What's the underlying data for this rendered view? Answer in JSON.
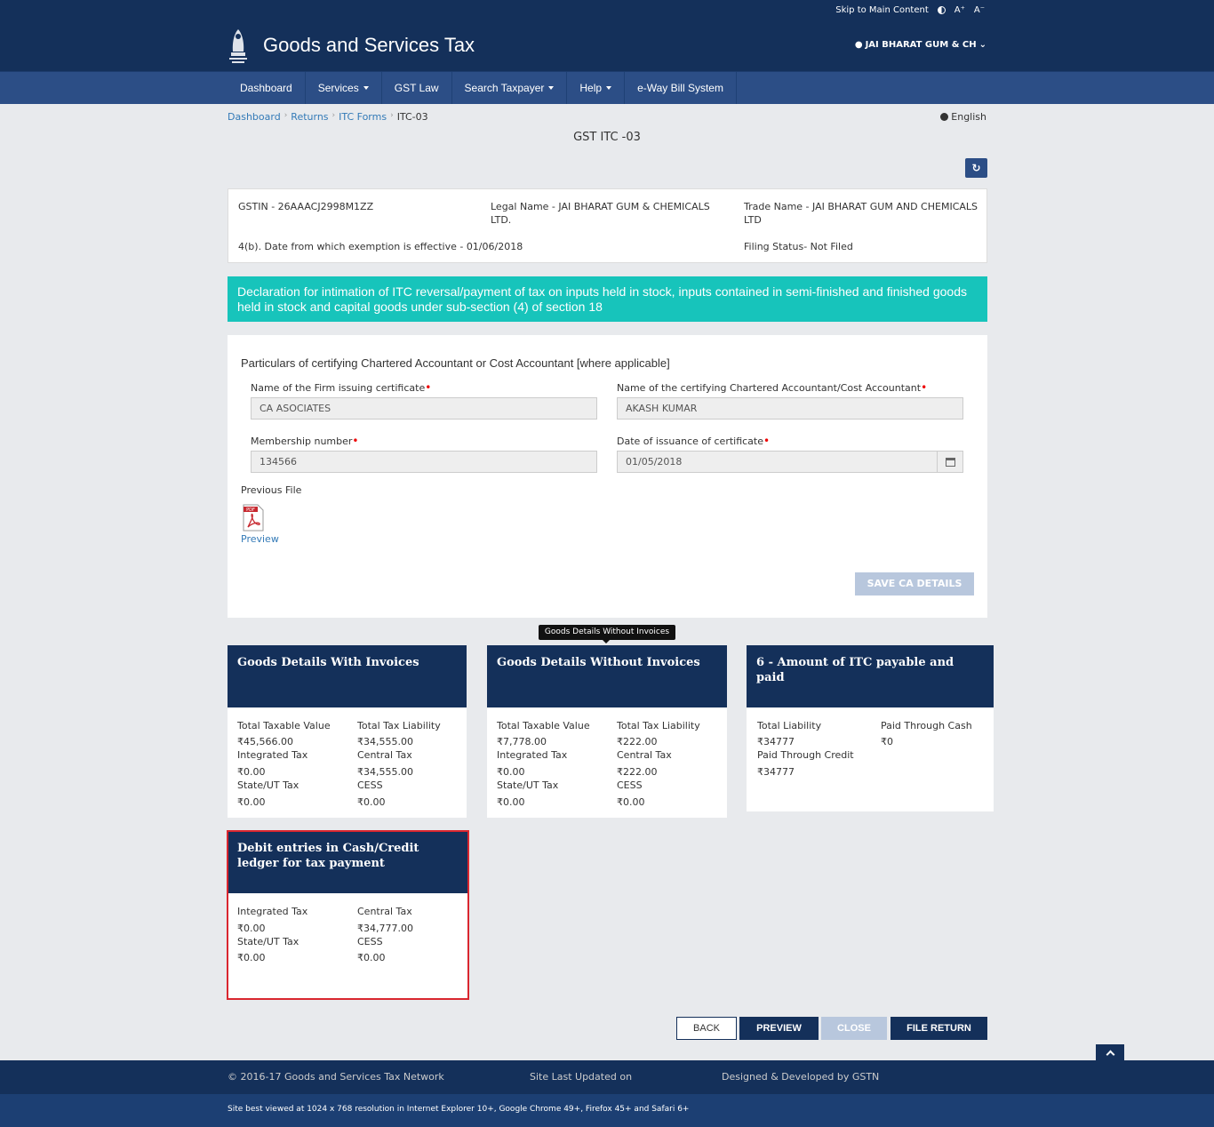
{
  "topbar": {
    "skip": "Skip to Main Content",
    "font_up": "A⁺",
    "font_down": "A⁻"
  },
  "header": {
    "title": "Goods and Services Tax",
    "user": "JAI BHARAT GUM & CH"
  },
  "nav": [
    "Dashboard",
    "Services",
    "GST Law",
    "Search Taxpayer",
    "Help",
    "e-Way Bill System"
  ],
  "breadcrumb": [
    "Dashboard",
    "Returns",
    "ITC Forms",
    "ITC-03"
  ],
  "language": "English",
  "page_title": "GST ITC -03",
  "info": {
    "gstin": "GSTIN - 26AAACJ2998M1ZZ",
    "legal_name": "Legal Name - JAI BHARAT GUM & CHEMICALS LTD.",
    "trade_name": "Trade Name - JAI BHARAT GUM AND CHEMICALS LTD",
    "exemption_date": "4(b). Date from which exemption is effective - 01/06/2018",
    "filing_status": "Filing Status- Not Filed"
  },
  "banner": "Declaration for intimation of ITC reversal/payment of tax on inputs held in stock, inputs contained in semi-finished and finished goods held in stock and capital goods under sub-section (4) of section 18",
  "ca_form": {
    "heading": "Particulars of certifying Chartered Accountant or Cost Accountant [where applicable]",
    "firm_label": "Name of the Firm issuing certificate",
    "firm_value": "CA ASOCIATES",
    "ca_name_label": "Name of the certifying Chartered Accountant/Cost Accountant",
    "ca_name_value": "AKASH KUMAR",
    "membership_label": "Membership number",
    "membership_value": "134566",
    "date_label": "Date of issuance of certificate",
    "date_value": "01/05/2018",
    "previous_file": "Previous File",
    "pdf_badge": "PDF",
    "preview_link": "Preview",
    "save_button": "SAVE CA DETAILS",
    "required_mark": "•"
  },
  "tooltip": "Goods Details Without Invoices",
  "tiles": {
    "with_invoices": {
      "title": "Goods Details With Invoices",
      "l1": "Total Taxable Value",
      "v1": "₹45,566.00",
      "l2": "Total Tax Liability",
      "v2": "₹34,555.00",
      "l3": "Integrated Tax",
      "v3": "₹0.00",
      "l4": "Central Tax",
      "v4": "₹34,555.00",
      "l5": "State/UT Tax",
      "v5": "₹0.00",
      "l6": "CESS",
      "v6": "₹0.00"
    },
    "without_invoices": {
      "title": "Goods Details Without Invoices",
      "l1": "Total Taxable Value",
      "v1": "₹7,778.00",
      "l2": "Total Tax Liability",
      "v2": "₹222.00",
      "l3": "Integrated Tax",
      "v3": "₹0.00",
      "l4": "Central Tax",
      "v4": "₹222.00",
      "l5": "State/UT Tax",
      "v5": "₹0.00",
      "l6": "CESS",
      "v6": "₹0.00"
    },
    "itc_payable": {
      "title": "6 - Amount of ITC payable and paid",
      "l1": "Total Liability",
      "v1": "₹34777",
      "l2": "Paid Through Cash",
      "v2": "₹0",
      "l3": "Paid Through Credit",
      "v3": "₹34777"
    },
    "debit_entries": {
      "title": "Debit entries in Cash/Credit ledger for tax payment",
      "l1": "Integrated Tax",
      "v1": "₹0.00",
      "l2": "Central Tax",
      "v2": "₹34,777.00",
      "l3": "State/UT Tax",
      "v3": "₹0.00",
      "l4": "CESS",
      "v4": "₹0.00"
    }
  },
  "buttons": {
    "back": "BACK",
    "preview": "PREVIEW",
    "close": "CLOSE",
    "file_return": "FILE RETURN"
  },
  "footer": {
    "copyright": "© 2016-17 Goods and Services Tax Network",
    "updated": "Site Last Updated on",
    "designed": "Designed & Developed by GSTN",
    "best_viewed": "Site best viewed at 1024 x 768 resolution in Internet Explorer 10+, Google Chrome 49+, Firefox 45+ and Safari 6+"
  },
  "colors": {
    "navy": "#14305a",
    "nav_blue": "#2c4e86",
    "teal": "#17c4bb",
    "selected_border": "#d9262f",
    "disabled": "#b8c7dd"
  }
}
